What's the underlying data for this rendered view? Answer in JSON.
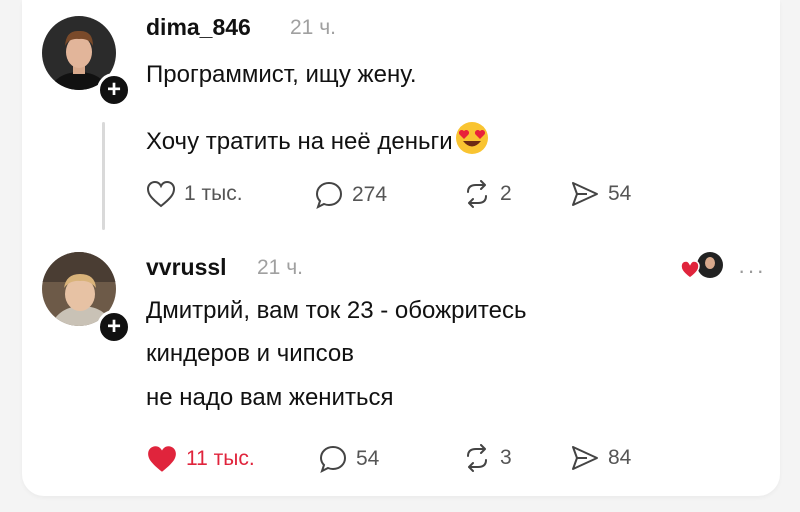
{
  "comments": [
    {
      "username": "dima_846",
      "time": "21 ч.",
      "lines": [
        "Программист, ищу жену.",
        "Хочу тратить на неё деньги"
      ],
      "emoji": "heart-eyes-emoji",
      "actions": {
        "likes": "1 тыс.",
        "replies": "274",
        "reposts": "2",
        "shares": "54"
      },
      "liked": false
    },
    {
      "username": "vvrussl",
      "time": "21 ч.",
      "lines": [
        "Дмитрий, вам ток 23 - обожритесь",
        "киндеров и чипсов",
        "не надо вам жениться"
      ],
      "actions": {
        "likes": "11 тыс.",
        "replies": "54",
        "reposts": "3",
        "shares": "84"
      },
      "liked": true,
      "more_label": "···"
    }
  ],
  "colors": {
    "like_active": "#e0243c",
    "muted": "#a0a0a0",
    "text": "#111111"
  }
}
